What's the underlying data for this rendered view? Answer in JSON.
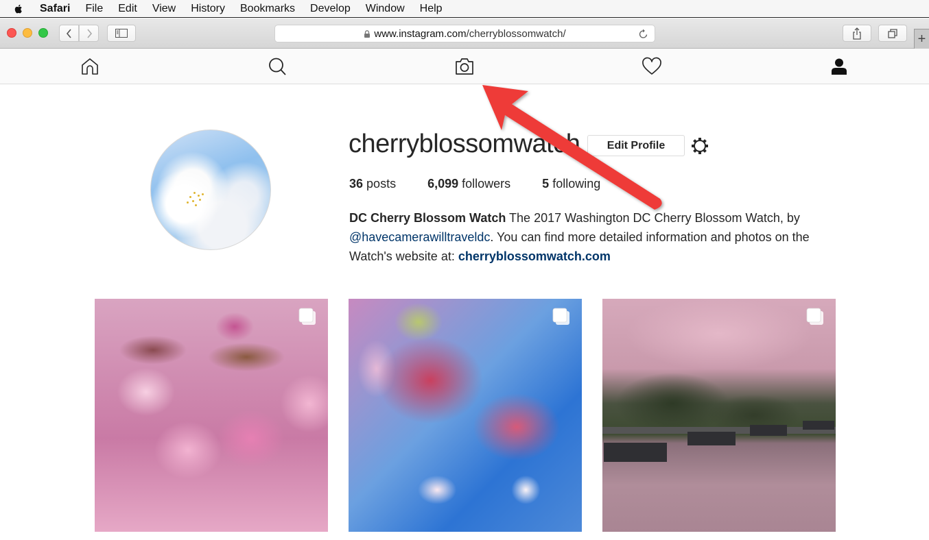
{
  "menubar": {
    "app_name": "Safari",
    "items": [
      "File",
      "Edit",
      "View",
      "History",
      "Bookmarks",
      "Develop",
      "Window",
      "Help"
    ]
  },
  "browser": {
    "url_domain": "www.instagram.com",
    "url_path": "/cherryblossomwatch/",
    "traffic_lights": {
      "close": "#fc5753",
      "minimize": "#fdbc40",
      "zoom": "#33c748"
    },
    "new_tab_label": "+"
  },
  "instagram_nav": {
    "icons": [
      "home-icon",
      "search-icon",
      "camera-icon",
      "heart-icon",
      "profile-icon"
    ]
  },
  "profile": {
    "username": "cherryblossomwatch",
    "edit_profile_label": "Edit Profile",
    "stats": {
      "posts_count": "36",
      "posts_label": "posts",
      "followers_count": "6,099",
      "followers_label": "followers",
      "following_count": "5",
      "following_label": "following"
    },
    "bio": {
      "display_name": "DC Cherry Blossom Watch",
      "text_1": " The 2017 Washington DC Cherry Blossom Watch, by ",
      "mention": "@havecamerawilltraveldc",
      "text_2": ". You can find more detailed information and photos on the Watch's website at: ",
      "website": "cherryblossomwatch.com"
    }
  },
  "posts": [
    {
      "subject": "pink double cherry blossoms",
      "multi_image": true
    },
    {
      "subject": "cherry blossom stamens against blue sky",
      "multi_image": true
    },
    {
      "subject": "cherry trees over petal-covered walkway with benches",
      "multi_image": true
    }
  ],
  "annotation": {
    "arrow_color": "#ee3b37",
    "points_to": "camera-icon"
  }
}
